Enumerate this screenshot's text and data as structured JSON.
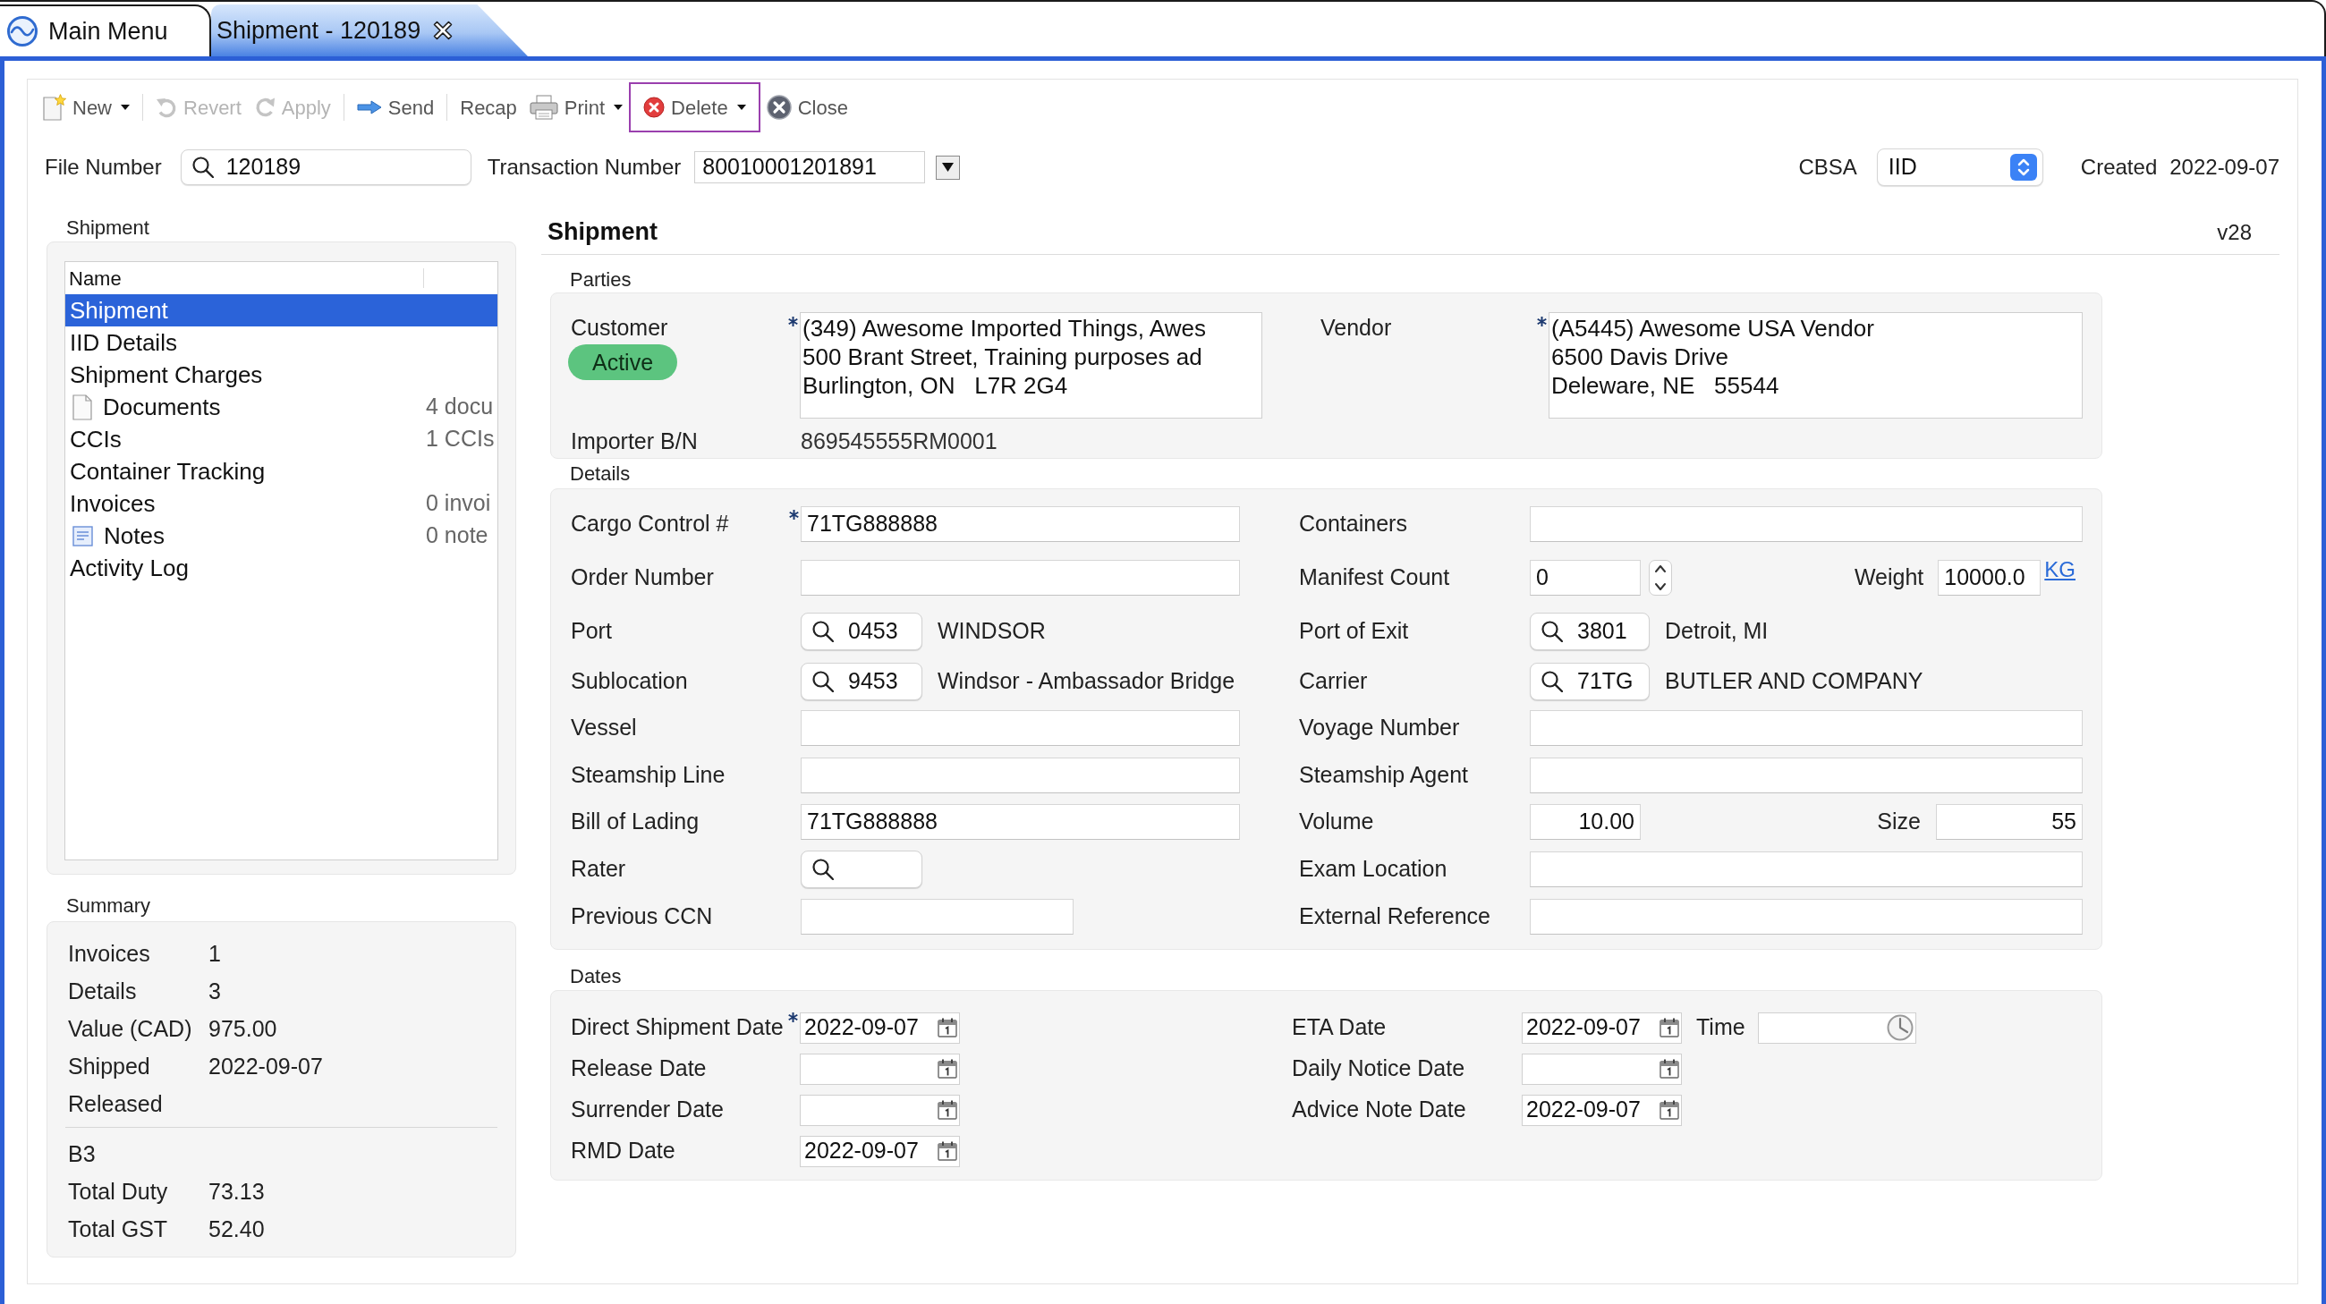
{
  "tabs": [
    {
      "label": "Main Menu",
      "kind": "home",
      "selected": false,
      "closable": false
    },
    {
      "label": "Shipment - 120189",
      "kind": "record",
      "selected": true,
      "closable": true
    }
  ],
  "toolbar": {
    "groups": [
      [
        {
          "label": "New",
          "kind": "new",
          "disabled": false,
          "menu": true,
          "focused": false
        }
      ],
      [
        {
          "label": "Revert",
          "kind": "revert",
          "disabled": true,
          "menu": false,
          "focused": false
        },
        {
          "label": "Apply",
          "kind": "apply",
          "disabled": true,
          "menu": false,
          "focused": false
        }
      ],
      [
        {
          "label": "Send",
          "kind": "send",
          "disabled": false,
          "menu": false,
          "focused": false
        }
      ],
      [
        {
          "label": "Recap",
          "kind": "recap",
          "disabled": false,
          "menu": false,
          "focused": false
        },
        {
          "label": "Print",
          "kind": "print",
          "disabled": false,
          "menu": true,
          "focused": false
        },
        {
          "label": "Delete",
          "kind": "delete",
          "disabled": false,
          "menu": true,
          "focused": true
        },
        {
          "label": "Close",
          "kind": "close",
          "disabled": false,
          "menu": false,
          "focused": false
        }
      ]
    ]
  },
  "header": {
    "file_number": {
      "label": "File Number",
      "value": "120189"
    },
    "transaction_number": {
      "label": "Transaction Number",
      "value": "80010001201891"
    },
    "cbsa": {
      "label": "CBSA",
      "value": "IID"
    },
    "created": {
      "label": "Created",
      "value": "2022-09-07"
    }
  },
  "navigator": {
    "title": "Shipment",
    "column": "Name",
    "items": [
      {
        "label": "Shipment",
        "kind": "plain",
        "selected": true
      },
      {
        "label": "IID Details",
        "kind": "plain",
        "selected": false
      },
      {
        "label": "Shipment Charges",
        "kind": "plain",
        "selected": false
      },
      {
        "label": "Documents",
        "kind": "document",
        "selected": false,
        "info": "4 docu"
      },
      {
        "label": "CCIs",
        "kind": "plain",
        "selected": false,
        "info": "1 CCIs"
      },
      {
        "label": "Container Tracking",
        "kind": "plain",
        "selected": false
      },
      {
        "label": "Invoices",
        "kind": "plain",
        "selected": false,
        "info": "0 invoi"
      },
      {
        "label": "Notes",
        "kind": "notes",
        "selected": false,
        "info": "0 note"
      },
      {
        "label": "Activity Log",
        "kind": "plain",
        "selected": false
      }
    ]
  },
  "summary": {
    "title": "Summary",
    "groups": [
      [
        {
          "label": "Invoices",
          "value": "1"
        },
        {
          "label": "Details",
          "value": "3"
        },
        {
          "label": "Value (CAD)",
          "value": "975.00"
        },
        {
          "label": "Shipped",
          "value": "2022-09-07"
        },
        {
          "label": "Released"
        }
      ],
      [
        {
          "label": "B3"
        },
        {
          "label": "Total Duty",
          "value": "73.13"
        },
        {
          "label": "Total GST",
          "value": "52.40"
        }
      ]
    ]
  },
  "form": {
    "title": "Shipment",
    "version": "v28",
    "parties": {
      "title": "Parties",
      "customer": {
        "label": "Customer",
        "status": "Active",
        "required": true,
        "address": "(349) Awesome Imported Things, Awes\n500 Brant Street, Training purposes ad\nBurlington, ON   L7R 2G4"
      },
      "vendor": {
        "label": "Vendor",
        "required": true,
        "address": "(A5445) Awesome USA Vendor\n6500 Davis Drive\nDeleware, NE   55544"
      },
      "importer_bn": {
        "label": "Importer B/N",
        "value": "869545555RM0001"
      }
    },
    "details": {
      "title": "Details",
      "left": [
        {
          "kind": "text",
          "label": "Cargo Control #",
          "value": "71TG888888",
          "required": true
        },
        {
          "kind": "text",
          "label": "Order Number",
          "required": false
        },
        {
          "kind": "lookup",
          "label": "Port",
          "code": "0453",
          "description": "WINDSOR",
          "required": false
        },
        {
          "kind": "lookup",
          "label": "Sublocation",
          "code": "9453",
          "description": "Windsor - Ambassador Bridge",
          "required": false
        },
        {
          "kind": "text",
          "label": "Vessel",
          "required": false
        },
        {
          "kind": "text",
          "label": "Steamship Line",
          "required": false
        },
        {
          "kind": "text",
          "label": "Bill of Lading",
          "value": "71TG888888",
          "required": false
        },
        {
          "kind": "lookup",
          "label": "Rater",
          "required": false
        },
        {
          "kind": "short_text",
          "label": "Previous CCN",
          "required": false
        }
      ],
      "right": [
        {
          "kind": "text",
          "label": "Containers",
          "required": false
        },
        {
          "kind": "spinner",
          "label": "Manifest Count",
          "value": "0",
          "required": false,
          "extra": {
            "label": "Weight",
            "value": "10000.0",
            "unit": "KG"
          }
        },
        {
          "kind": "lookup",
          "label": "Port of Exit",
          "code": "3801",
          "description": "Detroit, MI",
          "required": false
        },
        {
          "kind": "lookup",
          "label": "Carrier",
          "code": "71TG",
          "description": "BUTLER AND COMPANY",
          "required": false
        },
        {
          "kind": "text",
          "label": "Voyage Number",
          "required": false
        },
        {
          "kind": "text",
          "label": "Steamship Agent",
          "required": false
        },
        {
          "kind": "pair",
          "label": "Volume",
          "value": "10.00",
          "required": false,
          "extra": {
            "label": "Size",
            "value": "55"
          }
        },
        {
          "kind": "text",
          "label": "Exam Location",
          "required": false
        },
        {
          "kind": "text",
          "label": "External Reference",
          "required": false
        }
      ]
    },
    "dates": {
      "title": "Dates",
      "left": [
        {
          "label": "Direct Shipment Date",
          "value": "2022-09-07",
          "required": true
        },
        {
          "label": "Release Date",
          "required": false
        },
        {
          "label": "Surrender Date",
          "required": false
        },
        {
          "label": "RMD Date",
          "value": "2022-09-07",
          "required": false
        }
      ],
      "right": [
        {
          "label": "ETA Date",
          "value": "2022-09-07",
          "required": false,
          "time": {
            "label": "Time"
          }
        },
        {
          "label": "Daily Notice Date",
          "required": false
        },
        {
          "label": "Advice Note Date",
          "value": "2022-09-07",
          "required": false
        }
      ]
    }
  }
}
